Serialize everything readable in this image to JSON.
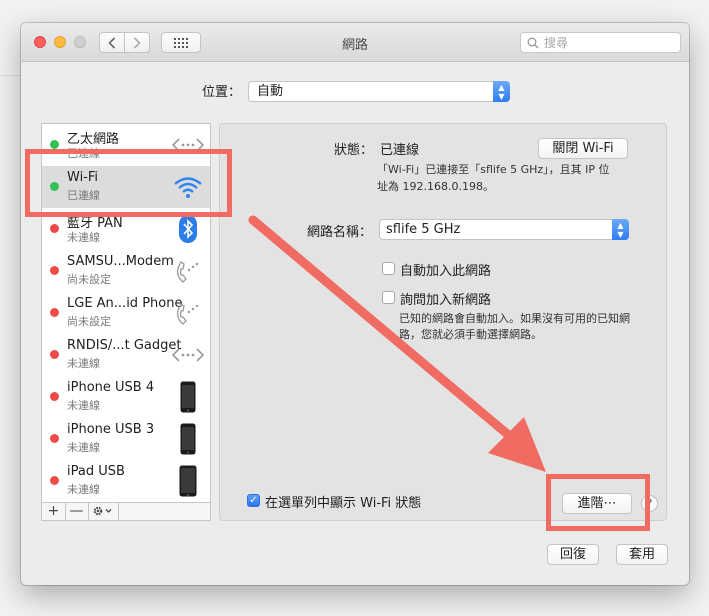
{
  "window": {
    "title": "網路",
    "search_placeholder": "搜尋"
  },
  "location": {
    "label": "位置：",
    "value": "自動"
  },
  "services": [
    {
      "name": "乙太網路",
      "status": "已連線",
      "dot": "green",
      "icon": "ethernet-icon"
    },
    {
      "name": "Wi-Fi",
      "status": "已連線",
      "dot": "green",
      "icon": "wifi-icon"
    },
    {
      "name": "藍牙 PAN",
      "status": "未連線",
      "dot": "red",
      "icon": "bluetooth-icon"
    },
    {
      "name": "SAMSU...Modem",
      "status": "尚未設定",
      "dot": "red",
      "icon": "phone-modem-icon"
    },
    {
      "name": "LGE An...id Phone",
      "status": "尚未設定",
      "dot": "red",
      "icon": "phone-modem-icon"
    },
    {
      "name": "RNDIS/...t Gadget",
      "status": "未連線",
      "dot": "red",
      "icon": "ethernet-icon"
    },
    {
      "name": "iPhone USB 4",
      "status": "未連線",
      "dot": "red",
      "icon": "iphone-icon"
    },
    {
      "name": "iPhone USB 3",
      "status": "未連線",
      "dot": "red",
      "icon": "iphone-icon"
    },
    {
      "name": "iPad USB",
      "status": "未連線",
      "dot": "red",
      "icon": "ipad-icon"
    }
  ],
  "sidebar_toolbar": {
    "add": "+",
    "remove": "—"
  },
  "detail": {
    "status_label": "狀態：",
    "status_value": "已連線",
    "turn_off_button": "關閉 Wi-Fi",
    "status_desc_line1": "「Wi-Fi」已連接至「sflife 5 GHz」，且其 IP 位",
    "status_desc_line2": "址為 192.168.0.198。",
    "network_name_label": "網路名稱：",
    "network_name_value": "sflife 5 GHz",
    "auto_join_label": "自動加入此網路",
    "ask_join_label": "詢問加入新網路",
    "ask_join_desc_line1": "已知的網路會自動加入。如果沒有可用的已知網",
    "ask_join_desc_line2": "路，您就必須手動選擇網路。",
    "show_menubar_label": "在選單列中顯示 Wi-Fi 狀態",
    "advanced_button": "進階⋯",
    "help_button": "?"
  },
  "footer": {
    "revert_button": "回復",
    "apply_button": "套用"
  },
  "colors": {
    "annotation": "#f06c62",
    "accent_blue": "#2f7df1",
    "status_green": "#2fc152",
    "status_red": "#ee4a48"
  }
}
